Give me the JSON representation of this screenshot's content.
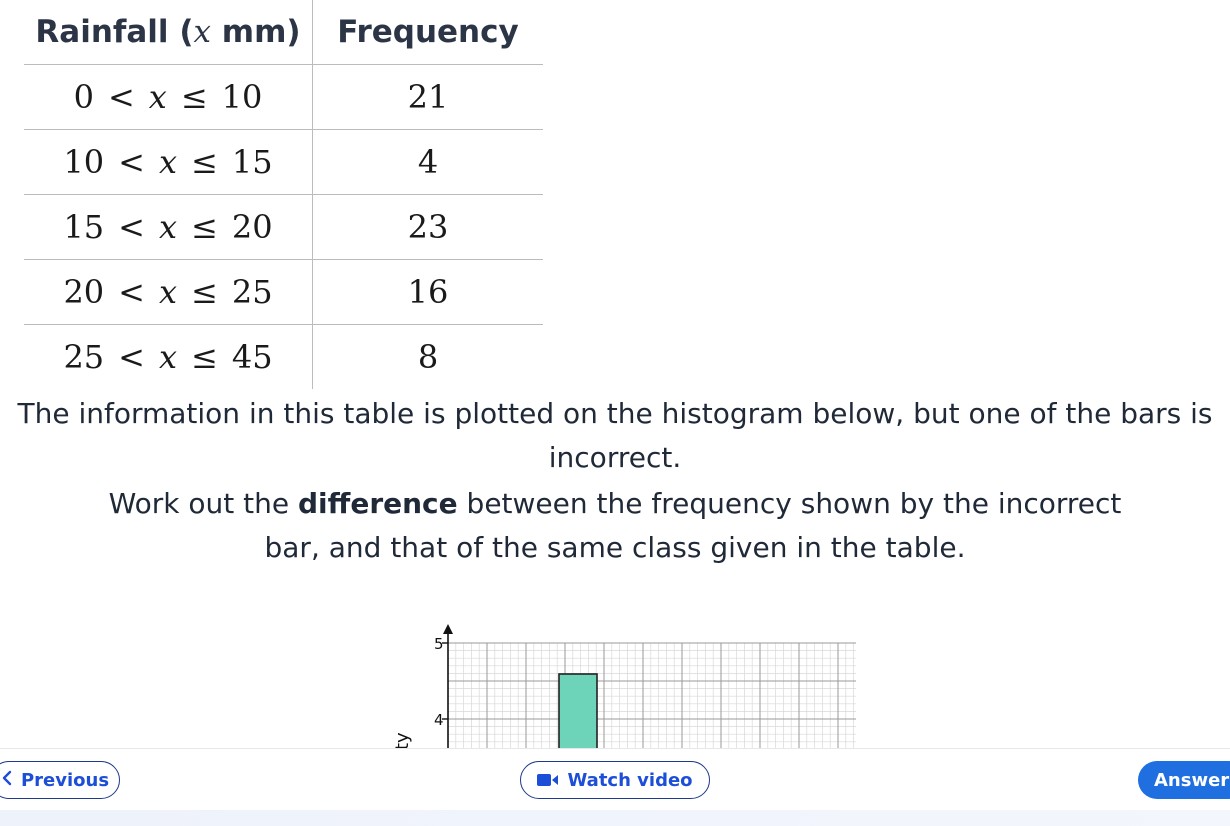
{
  "table": {
    "header": {
      "rainfall_prefix": "Rainfall (",
      "rainfall_var": "x",
      "rainfall_suffix": " mm)",
      "frequency": "Frequency"
    },
    "rows": [
      {
        "lo": "0",
        "hi": "10",
        "freq": "21"
      },
      {
        "lo": "10",
        "hi": "15",
        "freq": "4"
      },
      {
        "lo": "15",
        "hi": "20",
        "freq": "23"
      },
      {
        "lo": "20",
        "hi": "25",
        "freq": "16"
      },
      {
        "lo": "25",
        "hi": "45",
        "freq": "8"
      }
    ],
    "var": "x",
    "lt": "<",
    "le": "≤"
  },
  "question": {
    "line1": "The information in this table is plotted on the histogram below, but one of the bars is incorrect.",
    "line2_before": "Work out the ",
    "line2_bold": "difference",
    "line2_after": " between the frequency shown by the incorrect bar, and that of the same class given in the table."
  },
  "histogram": {
    "y_tick_5": "5",
    "y_tick_4": "4",
    "y_label_visible": "ty",
    "bar_color": "#6ed4b9"
  },
  "chart_data": {
    "type": "bar",
    "ylim_visible": [
      3.7,
      5.1
    ],
    "y_ticks": [
      4,
      5
    ],
    "bars": [
      {
        "value": 4.6
      }
    ]
  },
  "footer": {
    "previous": "Previous",
    "watch_video": "Watch video",
    "answer": "Answer"
  },
  "colors": {
    "accent": "#1d4ed8",
    "answer_bg": "#1f6fe0"
  }
}
